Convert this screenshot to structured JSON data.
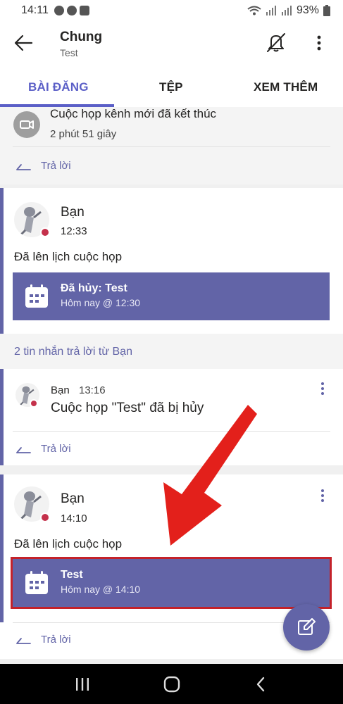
{
  "status_bar": {
    "time": "14:11",
    "battery": "93%"
  },
  "header": {
    "title": "Chung",
    "subtitle": "Test"
  },
  "tabs": [
    {
      "label": "BÀI ĐĂNG",
      "active": true
    },
    {
      "label": "TỆP",
      "active": false
    },
    {
      "label": "XEM THÊM",
      "active": false
    }
  ],
  "system_message": {
    "title": "Cuộc họp kênh mới đã kết thúc",
    "duration": "2 phút 51 giây",
    "reply_label": "Trả lời"
  },
  "post1": {
    "author": "Bạn",
    "time": "12:33",
    "text": "Đã lên lịch cuộc họp",
    "meeting": {
      "title": "Đã hủy: Test",
      "time": "Hôm nay @ 12:30"
    },
    "replies_summary": "2 tin nhắn trả lời từ Bạn",
    "reply": {
      "author": "Bạn",
      "time": "13:16",
      "text": "Cuộc họp \"Test\" đã bị hủy"
    },
    "reply_label": "Trả lời"
  },
  "post2": {
    "author": "Bạn",
    "time": "14:10",
    "text": "Đã lên lịch cuộc họp",
    "meeting": {
      "title": "Test",
      "time": "Hôm nay @ 14:10"
    },
    "reply_label": "Trả lời"
  },
  "colors": {
    "accent": "#6264a7",
    "active_tab": "#5b5fc7",
    "presence_busy": "#c4314b",
    "annotation_arrow": "#e3201b"
  },
  "icons": [
    "back-arrow-icon",
    "bell-off-icon",
    "more-vertical-icon",
    "meeting-icon",
    "reply-icon",
    "calendar-icon",
    "compose-icon"
  ]
}
